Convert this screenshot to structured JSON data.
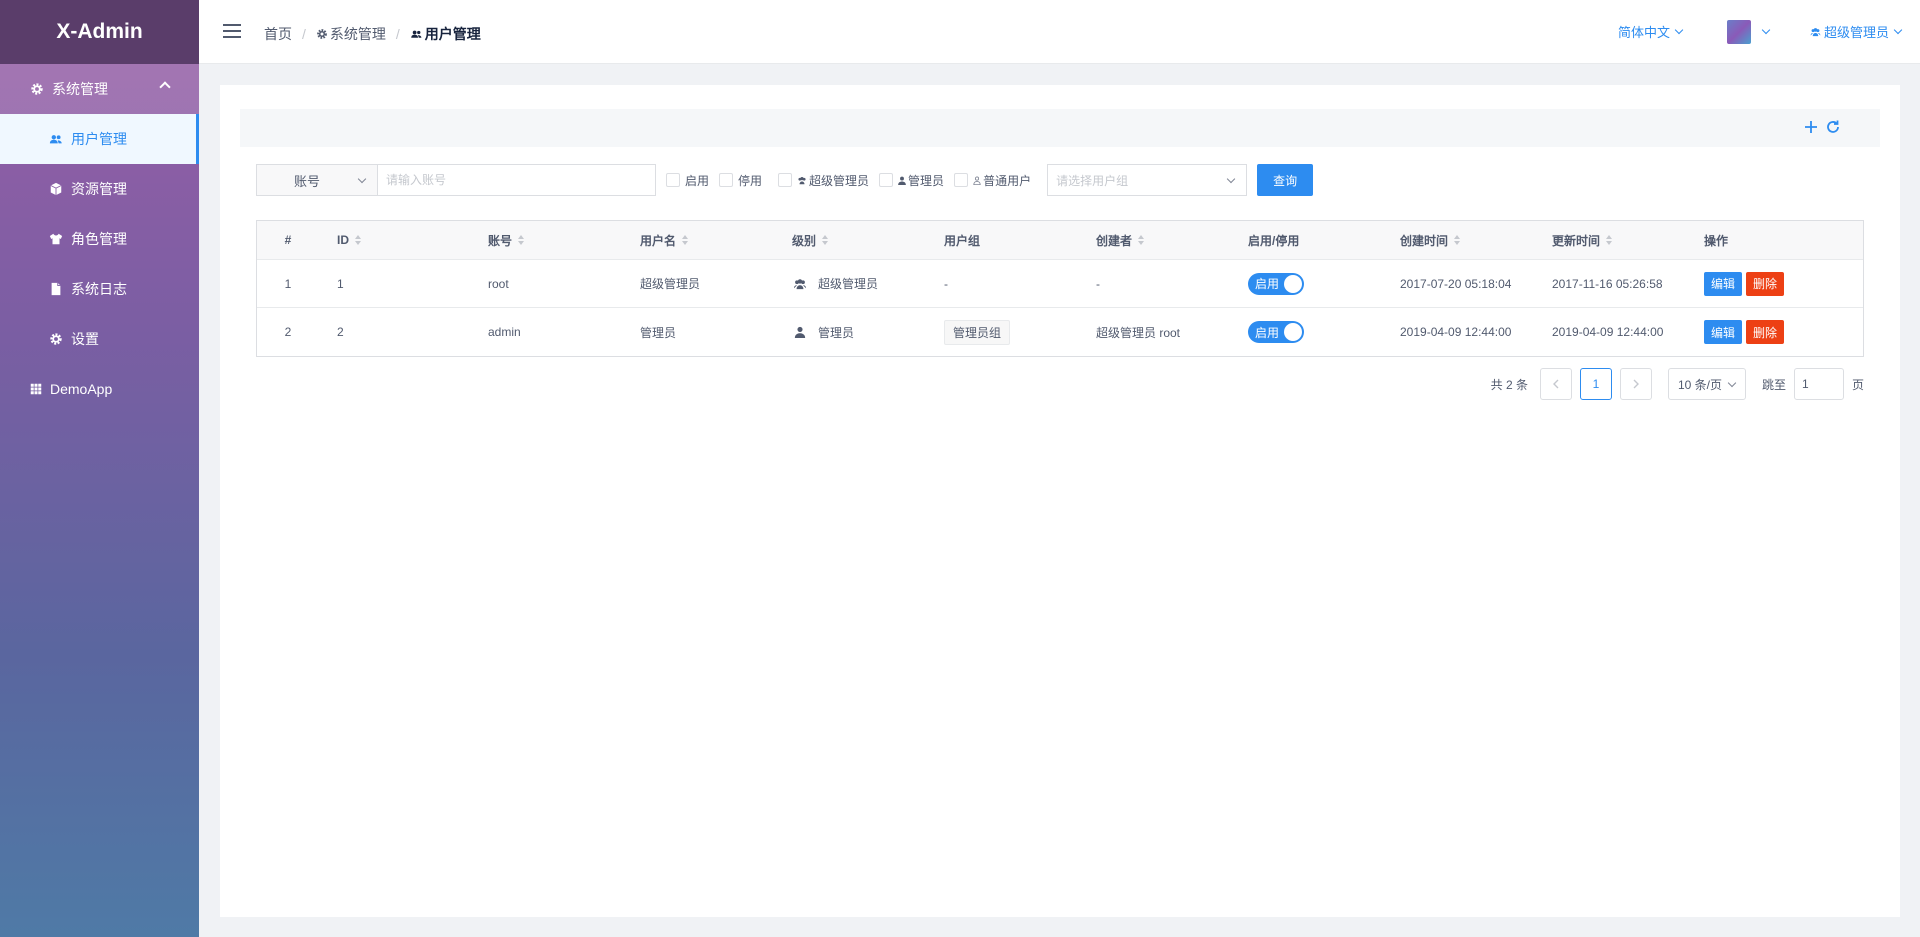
{
  "app": {
    "title": "X-Admin"
  },
  "sidebar": {
    "group": {
      "label": "系统管理"
    },
    "items": [
      {
        "label": "用户管理"
      },
      {
        "label": "资源管理"
      },
      {
        "label": "角色管理"
      },
      {
        "label": "系统日志"
      },
      {
        "label": "设置"
      }
    ],
    "demo": {
      "label": "DemoApp"
    }
  },
  "header": {
    "breadcrumb": {
      "home": "首页",
      "section": "系统管理",
      "current": "用户管理"
    },
    "language": "简体中文",
    "user": "超级管理员"
  },
  "search": {
    "type_label": "账号",
    "placeholder": "请输入账号",
    "status_enable": "启用",
    "status_disable": "停用",
    "level_super": "超级管理员",
    "level_admin": "管理员",
    "level_user": "普通用户",
    "group_placeholder": "请选择用户组",
    "query_label": "查询"
  },
  "table": {
    "headers": [
      "#",
      "ID",
      "账号",
      "用户名",
      "级别",
      "用户组",
      "创建者",
      "启用/停用",
      "创建时间",
      "更新时间",
      "操作"
    ],
    "rows": [
      {
        "index": "1",
        "id": "1",
        "account": "root",
        "username": "超级管理员",
        "level": "超级管理员",
        "group": "-",
        "creator": "-",
        "status": "启用",
        "created": "2017-07-20 05:18:04",
        "updated": "2017-11-16 05:26:58"
      },
      {
        "index": "2",
        "id": "2",
        "account": "admin",
        "username": "管理员",
        "level": "管理员",
        "group": "管理员组",
        "creator": "超级管理员 root",
        "status": "启用",
        "created": "2019-04-09 12:44:00",
        "updated": "2019-04-09 12:44:00"
      }
    ],
    "actions": {
      "edit": "编辑",
      "delete": "删除"
    }
  },
  "pager": {
    "total": "共 2 条",
    "current": "1",
    "size": "10 条/页",
    "jump_label": "跳至",
    "jump_value": "1",
    "page_suffix": "页"
  },
  "colors": {
    "primary": "#2d8cf0",
    "danger": "#ed4014",
    "logo_bg": "#5a3d6a"
  }
}
